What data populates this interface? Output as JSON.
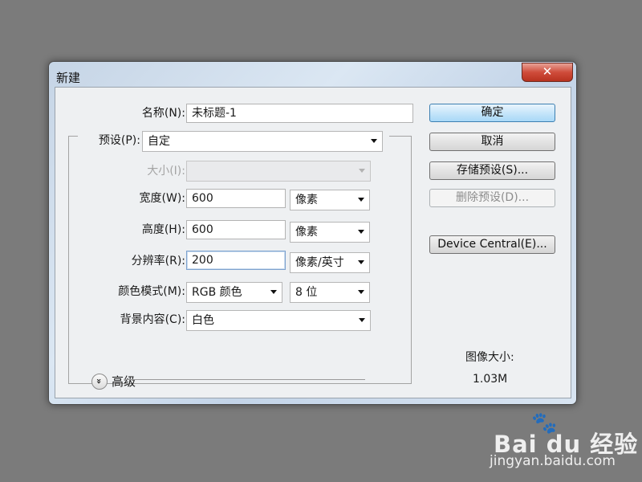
{
  "dialog": {
    "title": "新建",
    "close_symbol": "✕"
  },
  "form": {
    "name_label": "名称(N):",
    "name_value": "未标题-1",
    "preset_label": "预设(P):",
    "preset_value": "自定",
    "size_label": "大小(I):",
    "size_value": "",
    "width_label": "宽度(W):",
    "width_value": "600",
    "width_unit": "像素",
    "height_label": "高度(H):",
    "height_value": "600",
    "height_unit": "像素",
    "resolution_label": "分辨率(R):",
    "resolution_value": "200",
    "resolution_unit": "像素/英寸",
    "color_mode_label": "颜色模式(M):",
    "color_mode_value": "RGB 颜色",
    "bit_depth_value": "8 位",
    "background_label": "背景内容(C):",
    "background_value": "白色"
  },
  "advanced": {
    "label": "高级",
    "icon": "double-chevron-down-icon",
    "icon_glyph": "»"
  },
  "buttons": {
    "ok": "确定",
    "cancel": "取消",
    "save_preset": "存储预设(S)...",
    "delete_preset": "删除预设(D)...",
    "device_central": "Device Central(E)..."
  },
  "image_size": {
    "title": "图像大小:",
    "value": "1.03M"
  },
  "watermark": {
    "paw": "🐾",
    "brand": "Bai du 经验",
    "url": "jingyan.baidu.com"
  },
  "colors": {
    "desktop": "#7b7b7b",
    "default_button": "#a8d8f7",
    "close_button": "#cf4c3b"
  }
}
